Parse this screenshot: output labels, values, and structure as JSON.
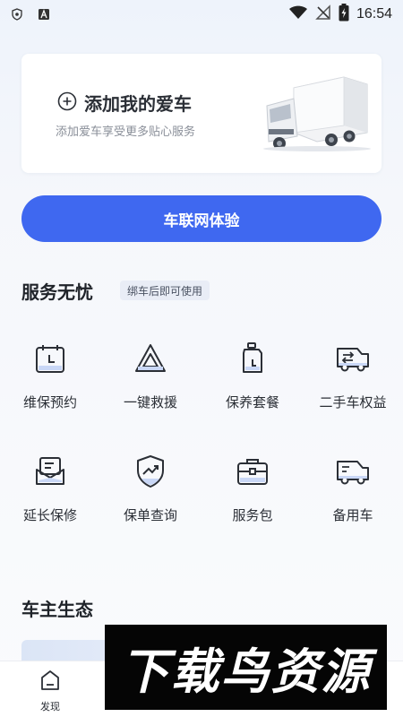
{
  "status_bar": {
    "time": "16:54",
    "left_icons": [
      "shield-icon",
      "a-badge-icon"
    ],
    "right_icons": [
      "wifi-icon",
      "no-signal-icon",
      "battery-charging-icon"
    ]
  },
  "car_card": {
    "add_title": "添加我的爱车",
    "add_subtitle": "添加爱车享受更多贴心服务",
    "image": "truck-illustration"
  },
  "primary_button": {
    "label": "车联网体验",
    "color": "#3f68f0"
  },
  "services": {
    "title": "服务无忧",
    "hint": "绑车后即可使用",
    "items": [
      {
        "label": "维保预约",
        "icon": "calendar-clock-icon"
      },
      {
        "label": "一键救援",
        "icon": "warning-triangle-icon"
      },
      {
        "label": "保养套餐",
        "icon": "oil-bottle-icon"
      },
      {
        "label": "二手车权益",
        "icon": "van-transfer-icon"
      },
      {
        "label": "延长保修",
        "icon": "envelope-doc-icon"
      },
      {
        "label": "保单查询",
        "icon": "shield-trend-icon"
      },
      {
        "label": "服务包",
        "icon": "briefcase-icon"
      },
      {
        "label": "备用车",
        "icon": "van-icon"
      }
    ]
  },
  "ecosystem": {
    "title": "车主生态"
  },
  "tab_bar": {
    "items": [
      {
        "label": "发现",
        "icon": "home-icon"
      }
    ]
  },
  "watermark": {
    "text": "下载鸟资源"
  }
}
